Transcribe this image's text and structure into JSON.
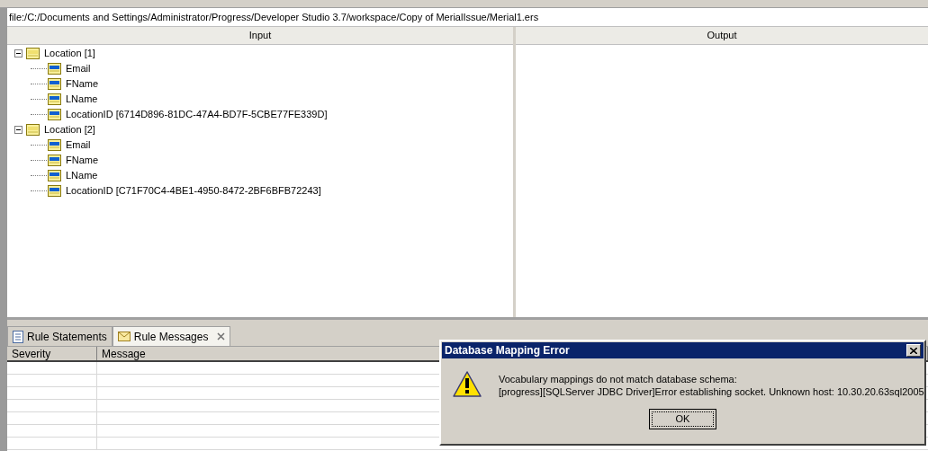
{
  "path_field": {
    "value": "file:/C:/Documents and Settings/Administrator/Progress/Developer Studio 3.7/workspace/Copy of MerialIssue/Merial1.ers"
  },
  "input_panel": {
    "header": "Input",
    "tree": [
      {
        "label": "Location [1]",
        "expanded": true,
        "children": [
          {
            "label": "Email"
          },
          {
            "label": "FName"
          },
          {
            "label": "LName"
          },
          {
            "label": "LocationID [6714D896-81DC-47A4-BD7F-5CBE77FE339D]"
          }
        ]
      },
      {
        "label": "Location [2]",
        "expanded": true,
        "children": [
          {
            "label": "Email"
          },
          {
            "label": "FName"
          },
          {
            "label": "LName"
          },
          {
            "label": "LocationID [C71F70C4-4BE1-4950-8472-2BF6BFB72243]"
          }
        ]
      }
    ]
  },
  "output_panel": {
    "header": "Output"
  },
  "bottom_tabs": [
    {
      "label": "Rule Statements",
      "kind": "document",
      "selected": false,
      "closable": false
    },
    {
      "label": "Rule Messages",
      "kind": "envelope",
      "selected": true,
      "closable": true
    }
  ],
  "messages_table": {
    "columns": [
      "Severity",
      "Message"
    ]
  },
  "dialog": {
    "title": "Database Mapping Error",
    "lines": [
      "Vocabulary mappings do not match database schema:",
      "[progress][SQLServer JDBC Driver]Error establishing socket. Unknown host: 10.30.20.63sql2005"
    ],
    "button": "OK"
  }
}
